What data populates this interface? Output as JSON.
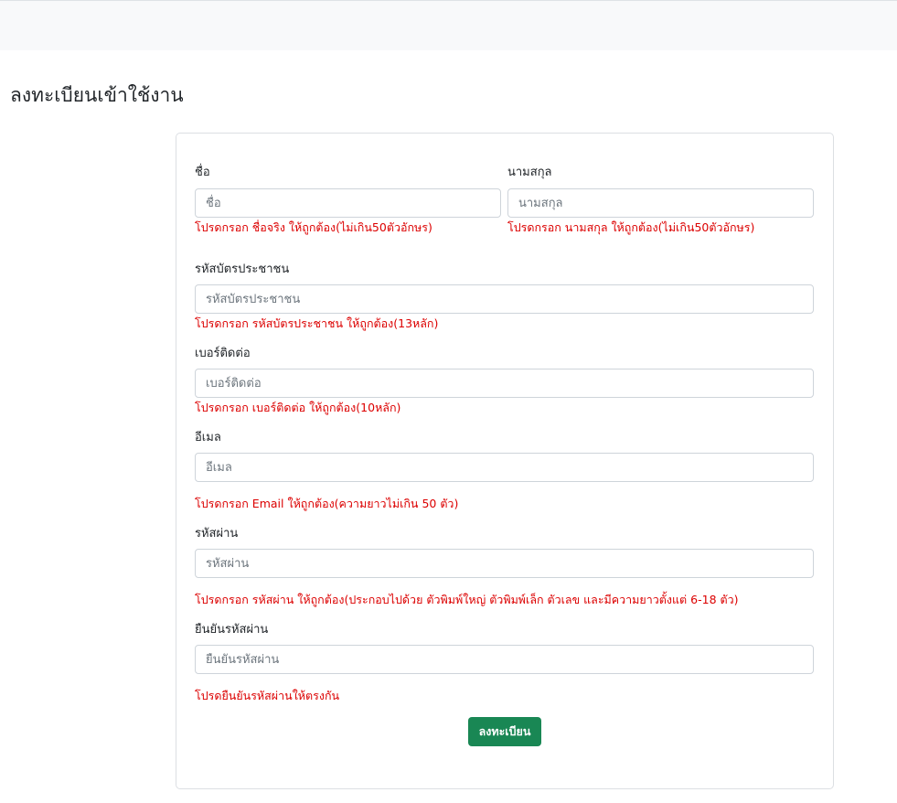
{
  "page": {
    "title": "ลงทะเบียนเข้าใช้งาน"
  },
  "form": {
    "first_name": {
      "label": "ชื่อ",
      "placeholder": "ชื่อ",
      "value": "",
      "error": "โปรดกรอก ชื่อจริง ให้ถูกต้อง(ไม่เกิน50ตัวอักษร)"
    },
    "last_name": {
      "label": "นามสกุล",
      "placeholder": "นามสกุล",
      "value": "",
      "error": "โปรดกรอก นามสกุล ให้ถูกต้อง(ไม่เกิน50ตัวอักษร)"
    },
    "id_card": {
      "label": "รหัสบัตรประชาชน",
      "placeholder": "รหัสบัตรประชาชน",
      "value": "",
      "error": "โปรดกรอก รหัสบัตรประชาชน ให้ถูกต้อง(13หลัก)"
    },
    "phone": {
      "label": "เบอร์ติดต่อ",
      "placeholder": "เบอร์ติดต่อ",
      "value": "",
      "error": "โปรดกรอก เบอร์ติดต่อ ให้ถูกต้อง(10หลัก)"
    },
    "email": {
      "label": "อีเมล",
      "placeholder": "อีเมล",
      "value": "",
      "error": "โปรดกรอก Email ให้ถูกต้อง(ความยาวไม่เกิน 50 ตัว)"
    },
    "password": {
      "label": "รหัสผ่าน",
      "placeholder": "รหัสผ่าน",
      "value": "",
      "error": "โปรดกรอก รหัสผ่าน ให้ถูกต้อง(ประกอบไปด้วย ตัวพิมพ์ใหญ่ ตัวพิมพ์เล็ก ตัวเลข และมีความยาวตั้งแต่ 6-18 ตัว)"
    },
    "confirm_password": {
      "label": "ยืนยันรหัสผ่าน",
      "placeholder": "ยืนยันรหัสผ่าน",
      "value": "",
      "error": "โปรดยืนยันรหัสผ่านให้ตรงกัน"
    },
    "submit_label": "ลงทะเบียน"
  },
  "colors": {
    "error": "#dc0000",
    "submit_button": "#198754",
    "topbar": "#f8f9fa"
  }
}
